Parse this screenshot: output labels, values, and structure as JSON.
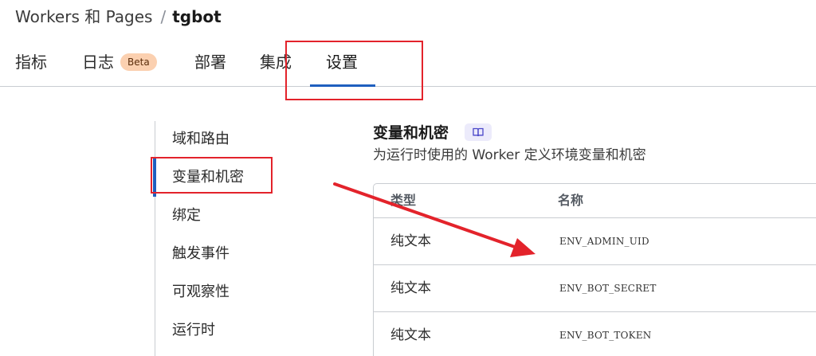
{
  "colors": {
    "accent": "#1f5fbf",
    "annotation_red": "#e3232b",
    "beta_badge_bg": "#fbd0b0",
    "doc_chip_bg": "#ecebfb"
  },
  "breadcrumb": {
    "parent": "Workers 和 Pages",
    "separator": "/",
    "current": "tgbot"
  },
  "tabs": [
    {
      "label": "指标"
    },
    {
      "label": "日志",
      "badge": "Beta"
    },
    {
      "label": "部署"
    },
    {
      "label": "集成"
    },
    {
      "label": "设置",
      "active": true
    }
  ],
  "sidebar": {
    "items": [
      {
        "label": "域和路由"
      },
      {
        "label": "变量和机密",
        "active": true
      },
      {
        "label": "绑定"
      },
      {
        "label": "触发事件"
      },
      {
        "label": "可观察性"
      },
      {
        "label": "运行时"
      }
    ]
  },
  "section": {
    "title": "变量和机密",
    "doc_icon": "book-icon",
    "subtitle": "为运行时使用的 Worker 定义环境变量和机密"
  },
  "table": {
    "columns": [
      "类型",
      "名称"
    ],
    "rows": [
      {
        "type": "纯文本",
        "name": "ENV_ADMIN_UID"
      },
      {
        "type": "纯文本",
        "name": "ENV_BOT_SECRET"
      },
      {
        "type": "纯文本",
        "name": "ENV_BOT_TOKEN"
      }
    ]
  },
  "annotations": {
    "boxes": [
      "tab-settings",
      "sidebar-item-variables-secrets"
    ],
    "arrow": "from-sidebar-to-table"
  }
}
